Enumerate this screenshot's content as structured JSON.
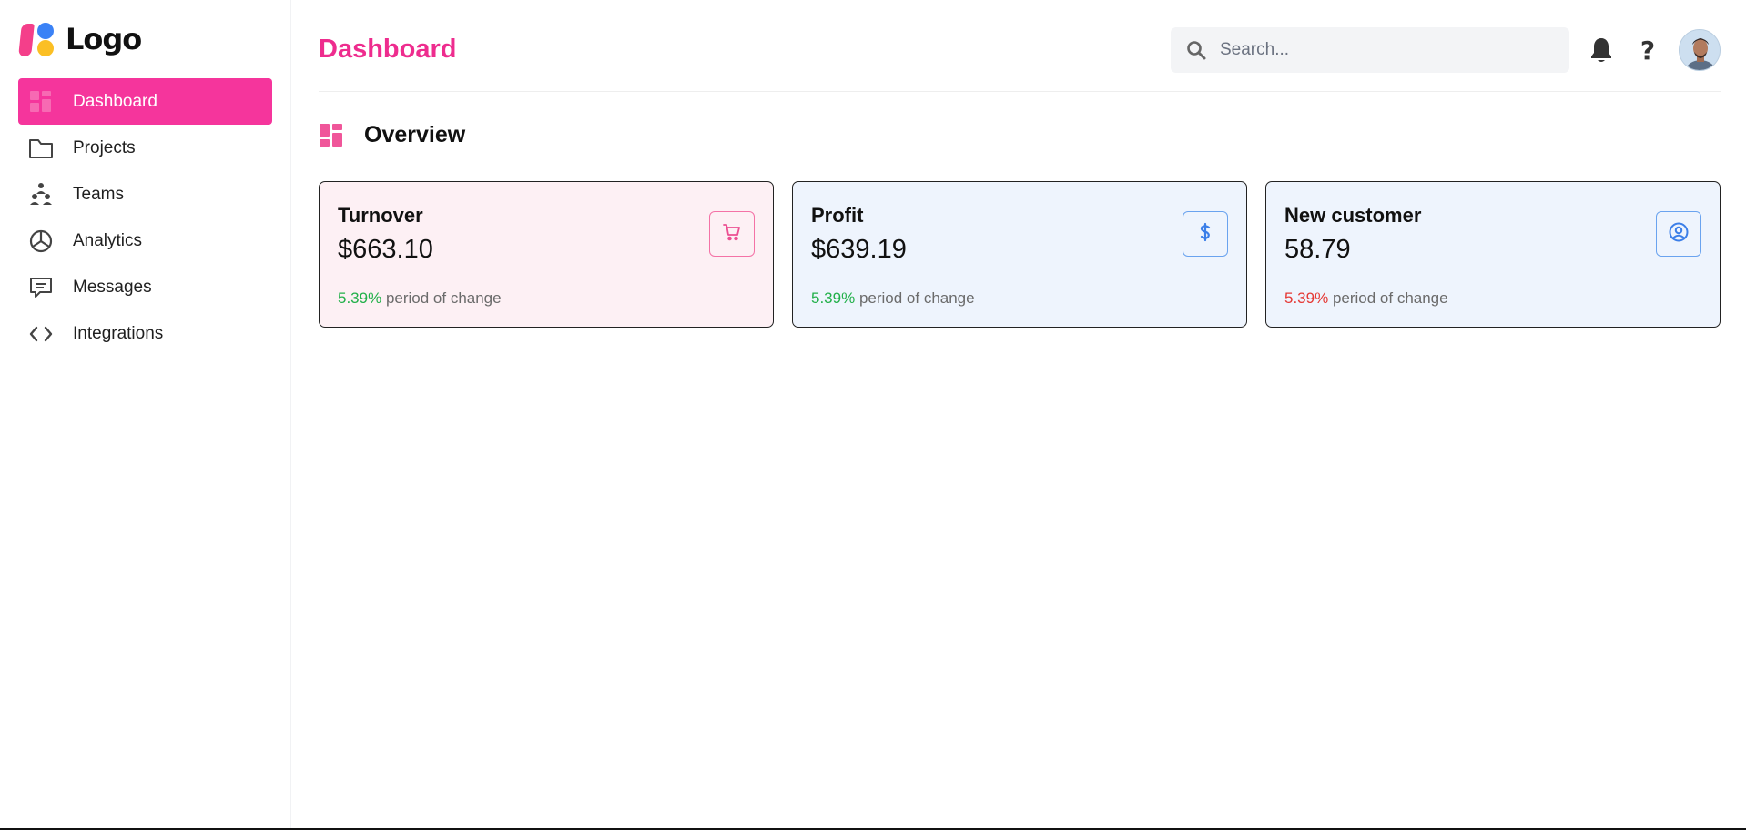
{
  "brand": {
    "logo_text": "Logo",
    "accent_color": "#f5359c",
    "title_color": "#ee2c8e"
  },
  "sidebar": {
    "items": [
      {
        "label": "Dashboard",
        "icon": "dashboard-grid-icon",
        "active": true
      },
      {
        "label": "Projects",
        "icon": "folder-icon",
        "active": false
      },
      {
        "label": "Teams",
        "icon": "team-icon",
        "active": false
      },
      {
        "label": "Analytics",
        "icon": "pie-chart-icon",
        "active": false
      },
      {
        "label": "Messages",
        "icon": "message-icon",
        "active": false
      },
      {
        "label": "Integrations",
        "icon": "code-icon",
        "active": false
      }
    ]
  },
  "header": {
    "title": "Dashboard",
    "search": {
      "placeholder": "Search...",
      "value": ""
    },
    "icons": [
      "search-icon",
      "bell-icon",
      "help-icon",
      "avatar"
    ],
    "help_glyph": "?"
  },
  "overview": {
    "title": "Overview",
    "cards": [
      {
        "title": "Turnover",
        "value": "$663.10",
        "change": "5.39%",
        "change_direction": "up",
        "change_suffix": "period of change",
        "icon": "cart-icon",
        "change_color": "#22b04a"
      },
      {
        "title": "Profit",
        "value": "$639.19",
        "change": "5.39%",
        "change_direction": "up",
        "change_suffix": "period of change",
        "icon": "dollar-icon",
        "change_color": "#22b04a"
      },
      {
        "title": "New customer",
        "value": "58.79",
        "change": "5.39%",
        "change_direction": "down",
        "change_suffix": "period of change",
        "icon": "user-circle-icon",
        "change_color": "#e53935"
      }
    ]
  }
}
